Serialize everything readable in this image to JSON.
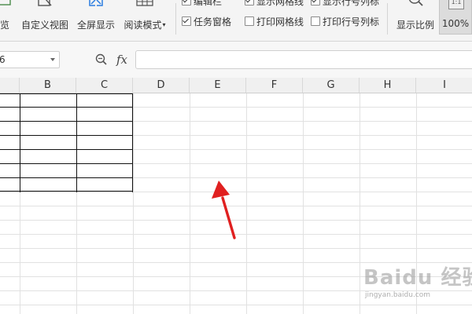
{
  "ribbon": {
    "buttons": [
      {
        "label": "览",
        "icon": "preview-icon"
      },
      {
        "label": "自定义视图",
        "icon": "custom-view-icon"
      },
      {
        "label": "全屏显示",
        "icon": "fullscreen-icon"
      },
      {
        "label": "阅读模式",
        "icon": "reading-mode-icon"
      }
    ],
    "checkboxes": [
      {
        "label": "编辑栏",
        "checked": true
      },
      {
        "label": "任务窗格",
        "checked": true
      },
      {
        "label": "显示网格线",
        "checked": true
      },
      {
        "label": "打印网格线",
        "checked": false
      },
      {
        "label": "显示行号列标",
        "checked": true
      },
      {
        "label": "打印行号列标",
        "checked": false
      }
    ],
    "zoom_ratio_label": "显示比例",
    "zoom_100_label": "100%",
    "zoom_100_icon_text": "1:1"
  },
  "formula_bar": {
    "name_box_value": "6",
    "fx_label": "fx",
    "formula_value": ""
  },
  "columns": [
    "B",
    "C",
    "D",
    "E",
    "F",
    "G",
    "H",
    "I"
  ],
  "watermark": {
    "logo": "Baidu 经验",
    "url": "jingyan.baidu.com"
  },
  "colors": {
    "arrow": "#e02020",
    "ribbon_bg": "#f4f4f4",
    "grid_line": "#e1e1e1",
    "table_border": "#111111"
  }
}
